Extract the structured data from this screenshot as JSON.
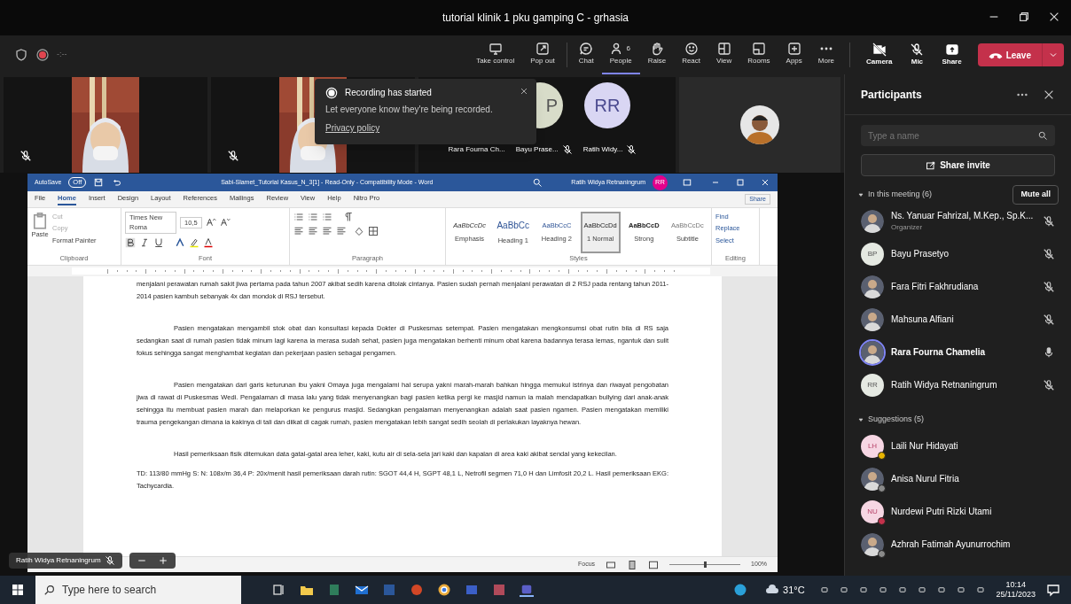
{
  "window": {
    "title": "tutorial klinik 1 pku gamping C - grhasia"
  },
  "meeting_bar": {
    "timer": "-:--",
    "recording": true,
    "tools": [
      {
        "label": "Take control",
        "selected": false
      },
      {
        "label": "Pop out",
        "selected": false
      },
      {
        "label": "Chat",
        "selected": false
      },
      {
        "label": "People",
        "selected": true,
        "badge": "6"
      },
      {
        "label": "Raise",
        "selected": false
      },
      {
        "label": "React",
        "selected": false
      },
      {
        "label": "View",
        "selected": false
      },
      {
        "label": "Rooms",
        "selected": false
      },
      {
        "label": "Apps",
        "selected": false
      },
      {
        "label": "More",
        "selected": false
      }
    ],
    "devices": [
      {
        "label": "Camera",
        "on": false
      },
      {
        "label": "Mic",
        "on": false
      },
      {
        "label": "Share"
      }
    ],
    "leave": "Leave"
  },
  "video_tiles": [
    {
      "kind": "video",
      "muted": true
    },
    {
      "kind": "video",
      "muted": true
    },
    {
      "kind": "group",
      "avatars": [
        "P",
        "RR"
      ],
      "names": [
        {
          "name": "Rara Fourna Ch..."
        },
        {
          "name": "Bayu Prase...",
          "muted": true
        },
        {
          "name": "Ratih Widy...",
          "muted": true
        }
      ]
    },
    {
      "kind": "avatar"
    }
  ],
  "toast": {
    "title": "Recording has started",
    "message": "Let everyone know they're being recorded.",
    "link": "Privacy policy"
  },
  "shared_screen": {
    "presenter": "Ratih Widya Retnaningrum",
    "word": {
      "autosave": "AutoSave",
      "autosave_state": "Off",
      "title": "Sabi-Slamet_Tutorial Kasus_N_3[1] - Read-Only - Compatibility Mode - Word",
      "user": "Ratih Widya Retnaningrum",
      "user_initials": "RR",
      "tabs": [
        {
          "label": "File",
          "selected": false
        },
        {
          "label": "Home",
          "selected": true
        },
        {
          "label": "Insert",
          "selected": false
        },
        {
          "label": "Design",
          "selected": false
        },
        {
          "label": "Layout",
          "selected": false
        },
        {
          "label": "References",
          "selected": false
        },
        {
          "label": "Mailings",
          "selected": false
        },
        {
          "label": "Review",
          "selected": false
        },
        {
          "label": "View",
          "selected": false
        },
        {
          "label": "Help",
          "selected": false
        },
        {
          "label": "Nitro Pro",
          "selected": false
        }
      ],
      "share": "Share",
      "clipboard": {
        "paste": "Paste",
        "items": [
          "Cut",
          "Copy",
          "Format Painter"
        ],
        "label": "Clipboard"
      },
      "font": {
        "name": "Times New Roma",
        "size": "10,5",
        "label": "Font"
      },
      "paragraph": {
        "label": "Paragraph"
      },
      "styles": {
        "label": "Styles",
        "items": [
          {
            "sample": "AaBbCcDc",
            "name": "Emphasis",
            "selected": false
          },
          {
            "sample": "AaBbCc",
            "name": "Heading 1",
            "selected": false
          },
          {
            "sample": "AaBbCcC",
            "name": "Heading 2",
            "selected": false
          },
          {
            "sample": "AaBbCcDd",
            "name": "1 Normal",
            "selected": true
          },
          {
            "sample": "AaBbCcD",
            "name": "Strong",
            "selected": false
          },
          {
            "sample": "AaBbCcDc",
            "name": "Subtitle",
            "selected": false
          }
        ]
      },
      "editing": {
        "label": "Editing",
        "items": [
          "Find",
          "Replace",
          "Select"
        ]
      },
      "paragraphs": [
        {
          "indent": false,
          "text": "menjalani perawatan rumah sakit jiwa pertama pada tahun 2007 akibat sedih karena ditolak cintanya. Pasien sudah pernah menjalani perawatan di 2 RSJ pada rentang tahun 2011-2014 pasien kambuh sebanyak 4x dan mondok di RSJ tersebut."
        },
        {
          "indent": true,
          "text": "Pasien mengatakan mengambil stok obat dan konsultasi kepada Dokter di Puskesmas setempat. Pasien mengatakan mengkonsumsi obat rutin bila di RS saja sedangkan saat di rumah pasien tidak minum lagi karena ia merasa sudah sehat, pasien juga mengatakan berhenti minum obat karena badannya terasa lemas, ngantuk dan sulit fokus sehingga sangat menghambat kegiatan dan pekerjaan pasien sebagai pengamen."
        },
        {
          "indent": true,
          "text": "Pasien mengatakan dari garis keturunan ibu yakni Omaya juga mengalami hal serupa yakni marah-marah bahkan hingga memukul istrinya dan riwayat pengobatan jiwa di rawat di Puskesmas Wedi. Pengalaman di masa lalu yang tidak menyenangkan bagi pasien ketika pergi ke masjid namun ia malah mendapatkan bullying dari anak-anak sehingga itu membuat pasien marah dan melaporkan ke pengurus masjid. Sedangkan pengalaman menyenangkan adalah saat pasien ngamen. Pasien mengatakan memiliki trauma pengekangan dimana ia kakinya di tali dan diikat di cagak rumah, pasien mengatakan lebih sangat sedih seolah di perlakukan layaknya hewan."
        },
        {
          "indent": true,
          "text": "Hasil pemeriksaan fisik ditemukan data gatal-gatal area leher, kaki, kutu air di sela-sela jari kaki dan kapalan di area kaki akibat sendal yang kekecilan."
        },
        {
          "indent": false,
          "text": "TD: 113/80 mmHg S: N: 108x/m 36,4 P: 20x/menit hasil pemeriksaan darah rutin: SGOT 44,4 H, SGPT 48,1 L, Netrofil segmen 71,0 H dan Limfosit 20,2 L. Hasil pemeriksaan EKG: Tachycardia."
        }
      ],
      "status": {
        "focus": "Focus",
        "zoom": "100%",
        "level": 0.5
      }
    }
  },
  "participants": {
    "title": "Participants",
    "search_placeholder": "Type a name",
    "share_invite": "Share invite",
    "in_meeting": {
      "label": "In this meeting (6)",
      "expanded": true,
      "mute_all": "Mute all",
      "people": [
        {
          "name": "Ns. Yanuar Fahrizal, M.Kep., Sp.K...",
          "role": "Organizer",
          "muted": true,
          "speaking": false
        },
        {
          "name": "Bayu Prasetyo",
          "initials": "BP",
          "kind": "initials",
          "muted": true,
          "speaking": false
        },
        {
          "name": "Fara Fitri Fakhrudiana",
          "muted": true,
          "speaking": false
        },
        {
          "name": "Mahsuna Alfiani",
          "muted": true,
          "speaking": false
        },
        {
          "name": "Rara Fourna Chamelia",
          "muted": false,
          "speaking": true
        },
        {
          "name": "Ratih Widya Retnaningrum",
          "initials": "RR",
          "kind": "initials",
          "muted": true,
          "speaking": false
        }
      ]
    },
    "suggestions": {
      "label": "Suggestions (5)",
      "expanded": true,
      "people": [
        {
          "name": "Laili Nur Hidayati",
          "initials": "LH",
          "kind": "initials",
          "color": "#e8b400"
        },
        {
          "name": "Anisa Nurul Fitria",
          "color": "#8a8a8a"
        },
        {
          "name": "Nurdewi Putri Rizki Utami",
          "initials": "NU",
          "kind": "initials",
          "color": "#c4314b"
        },
        {
          "name": "Azhrah Fatimah Ayunurrochim",
          "color": "#8a8a8a"
        }
      ]
    }
  },
  "taskbar": {
    "search_placeholder": "Type here to search",
    "temperature": "31°C",
    "time": "10:14",
    "date": "25/11/2023"
  }
}
